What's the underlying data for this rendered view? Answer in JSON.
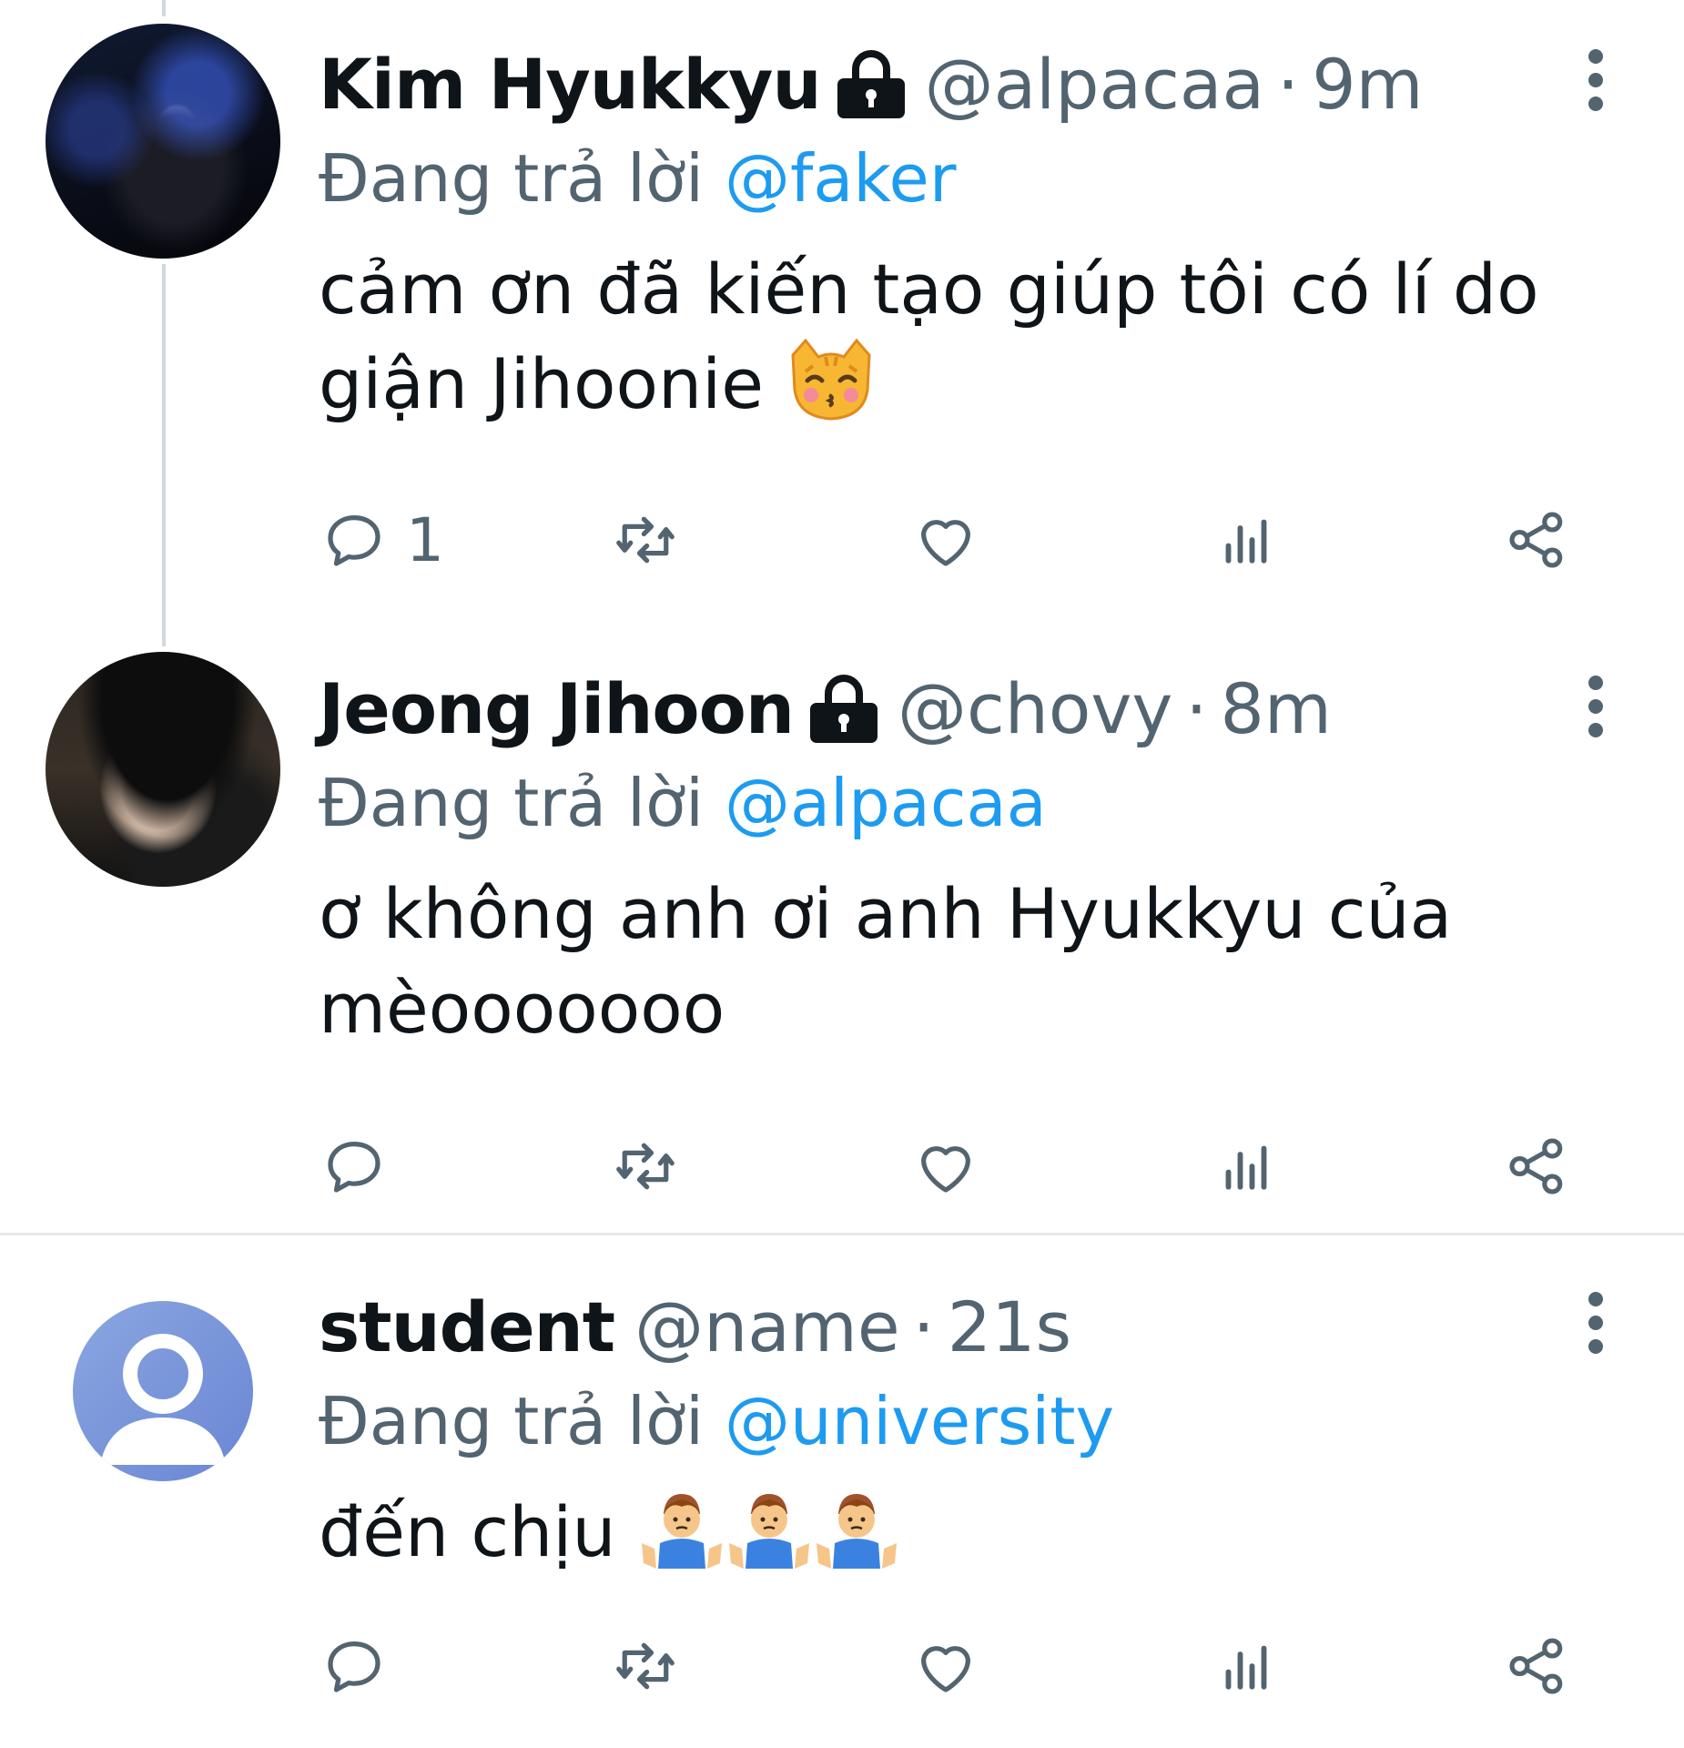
{
  "tweets": [
    {
      "display_name": "Kim Hyukkyu",
      "locked": true,
      "handle": "@alpacaa",
      "separator": "·",
      "time": "9m",
      "replying_prefix": "Đang trả lời",
      "replying_to": "@faker",
      "text_line1": "cảm ơn đã kiến tạo giúp tôi có lí do",
      "text_line2": "giận Jihoonie",
      "emoji": "kissing-cat",
      "reply_count": "1"
    },
    {
      "display_name": "Jeong Jihoon",
      "locked": true,
      "handle": "@chovy",
      "separator": "·",
      "time": "8m",
      "replying_prefix": "Đang trả lời",
      "replying_to": "@alpacaa",
      "text_line1": "ơ không anh ơi anh Hyukkyu của",
      "text_line2": "mèooooooo",
      "reply_count": ""
    },
    {
      "display_name": "student",
      "locked": false,
      "handle": "@name",
      "separator": "·",
      "time": "21s",
      "replying_prefix": "Đang trả lời",
      "replying_to": "@university",
      "text_line1": "đến chịu",
      "emoji": "person-shrugging",
      "emoji_count": 3,
      "reply_count": ""
    }
  ],
  "icons": [
    "reply-icon",
    "retweet-icon",
    "like-icon",
    "views-icon",
    "share-icon",
    "lock-icon",
    "more-icon",
    "default-avatar-icon"
  ],
  "colors": {
    "text": "#0f1419",
    "secondary": "#536471",
    "link": "#1d9bf0",
    "thread_line": "#cfd9de",
    "divider": "#e6e8ea",
    "default_avatar": "#7a96da"
  }
}
